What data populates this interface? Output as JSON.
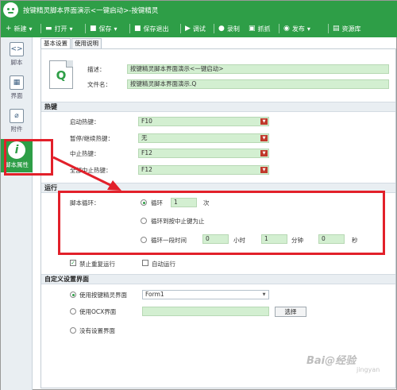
{
  "window": {
    "title": "按键精灵脚本界面演示<一键启动>-按键精灵"
  },
  "toolbar": {
    "new": "新建",
    "open": "打开",
    "save": "保存",
    "save_exit": "保存退出",
    "debug": "调试",
    "record": "录制",
    "capture": "抓抓",
    "publish": "发布",
    "resources": "资源库"
  },
  "sidebar": {
    "items": [
      {
        "label": "脚本"
      },
      {
        "label": "界面"
      },
      {
        "label": "附件"
      },
      {
        "label": "脚本属性"
      }
    ]
  },
  "tabs": [
    {
      "label": "基本设置"
    },
    {
      "label": "使用说明"
    }
  ],
  "basic": {
    "desc_label": "描述：",
    "desc_value": "按键精灵脚本界面演示<一键启动>",
    "filename_label": "文件名：",
    "filename_value": "按键精灵脚本界面演示.Q",
    "file_icon_letter": "Q"
  },
  "hotkeys": {
    "title": "热键",
    "start_label": "启动热键：",
    "start_value": "F10",
    "pause_label": "暂停/继续热键：",
    "pause_value": "无",
    "stop_label": "中止热键：",
    "stop_value": "F12",
    "full_stop_label": "全部中止热键：",
    "full_stop_value": "F12"
  },
  "run": {
    "title": "运行",
    "loop_label": "脚本循环：",
    "loop_times_label": "循环",
    "loop_times_value": "1",
    "loop_times_unit": "次",
    "loop_until_label": "循环到按中止键为止",
    "loop_period_label": "循环一段时间",
    "hours_value": "0",
    "hours_unit": "小时",
    "minutes_value": "1",
    "minutes_unit": "分钟",
    "seconds_value": "0",
    "seconds_unit": "秒",
    "no_repeat_label": "禁止重复运行",
    "no_repeat_checked": true,
    "auto_run_label": "自动运行",
    "auto_run_checked": false
  },
  "custom": {
    "title": "自定义设置界面",
    "use_qmacro_label": "使用按键精灵界面",
    "form_value": "Form1",
    "use_ocx_label": "使用OCX界面",
    "select_button": "选择",
    "no_ui_label": "没有设置界面"
  },
  "watermark": {
    "text": "Bai@经验",
    "sub": "jingyan"
  },
  "colors": {
    "brand": "#2e9e47",
    "field_bg": "#d3efd1",
    "annotation": "#e2202a"
  },
  "icons": {
    "sidebar_script": "script-icon",
    "sidebar_ui": "grid-icon",
    "sidebar_attach": "paperclip-icon",
    "sidebar_props": "info-icon"
  }
}
